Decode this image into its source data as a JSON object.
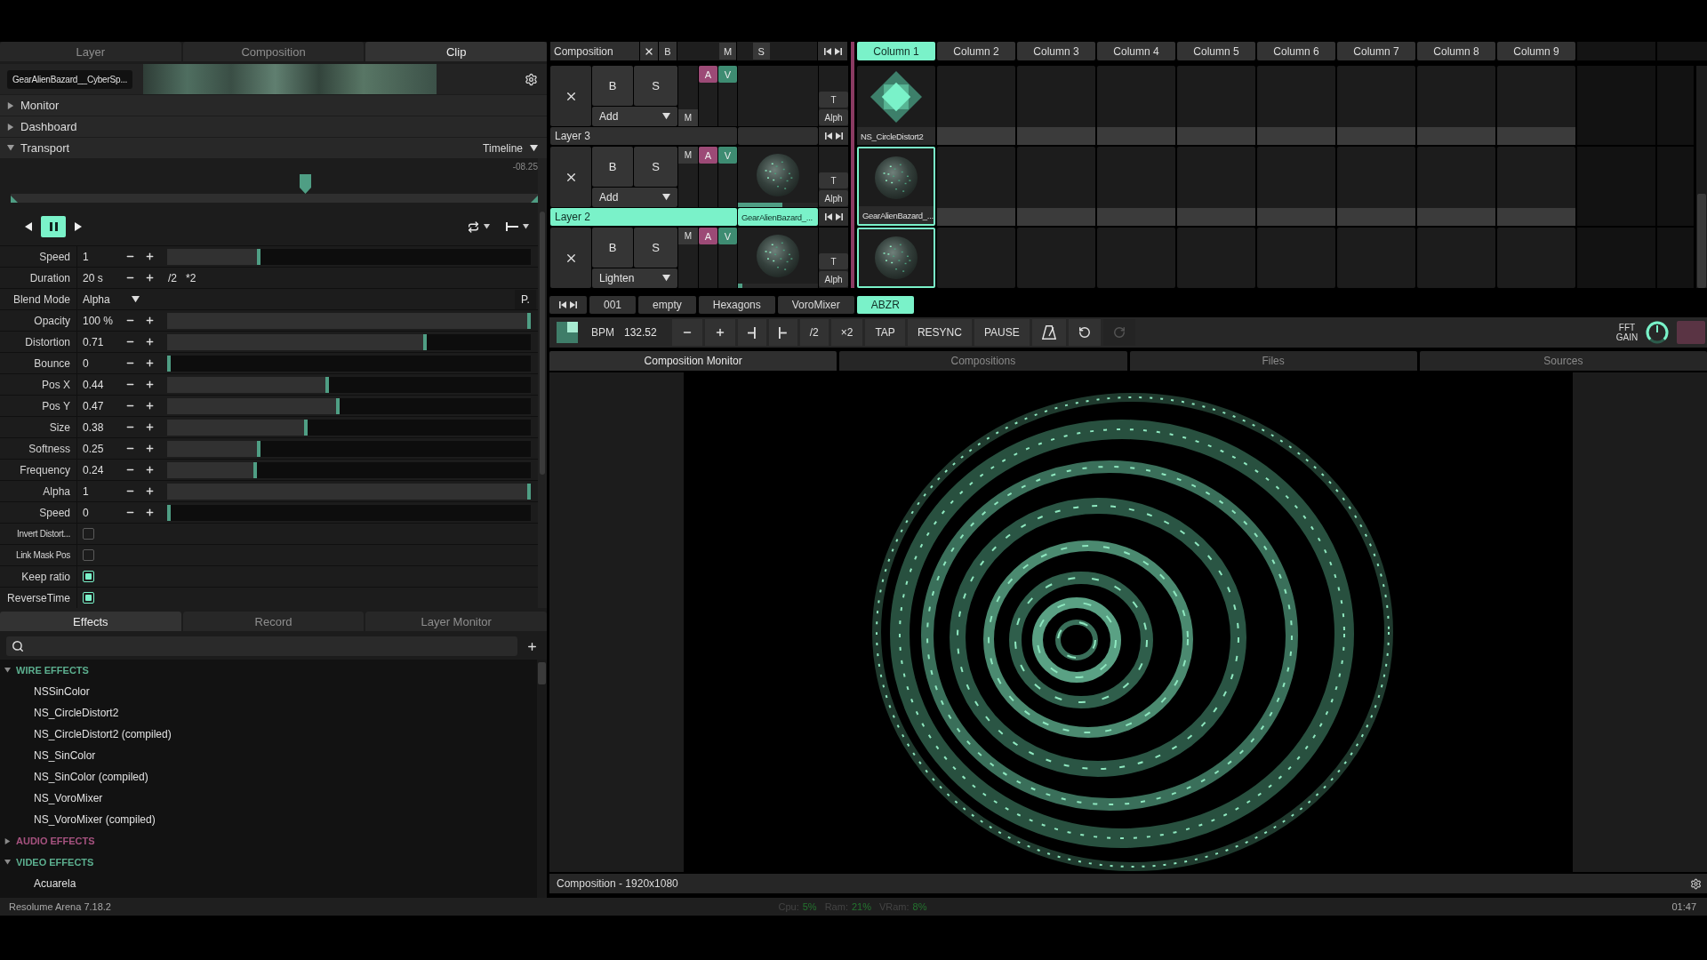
{
  "left_panel": {
    "tabs": [
      {
        "label": "Layer",
        "selected": false
      },
      {
        "label": "Composition",
        "selected": false
      },
      {
        "label": "Clip",
        "selected": true
      }
    ],
    "clip_name": "GearAlienBazard__CyberSp...",
    "sections": [
      {
        "label": "Monitor",
        "expanded": false
      },
      {
        "label": "Dashboard",
        "expanded": false
      },
      {
        "label": "Transport",
        "expanded": true,
        "mode": "Timeline"
      }
    ],
    "timeline": {
      "time": "-08.25",
      "level": 0.56
    },
    "transport": [
      {
        "kind": "backward",
        "selected": false
      },
      {
        "kind": "pause",
        "selected": true
      },
      {
        "kind": "forward",
        "selected": false
      }
    ],
    "params": [
      {
        "kind": "slider",
        "label": "Speed",
        "value": "1",
        "level": 0.25
      },
      {
        "kind": "duration",
        "label": "Duration",
        "value": "20 s",
        "factors": [
          "/2",
          "*2"
        ]
      },
      {
        "kind": "dropdown",
        "label": "Blend Mode",
        "value": "Alpha",
        "button": "P."
      },
      {
        "kind": "slider",
        "label": "Opacity",
        "value": "100 %",
        "level": 1
      },
      {
        "kind": "slider",
        "label": "Distortion",
        "value": "0.71",
        "level": 0.71
      },
      {
        "kind": "slider",
        "label": "Bounce",
        "value": "0",
        "level": 0
      },
      {
        "kind": "slider",
        "label": "Pos X",
        "value": "0.44",
        "level": 0.44
      },
      {
        "kind": "slider",
        "label": "Pos Y",
        "value": "0.47",
        "level": 0.47
      },
      {
        "kind": "slider",
        "label": "Size",
        "value": "0.38",
        "level": 0.38
      },
      {
        "kind": "slider",
        "label": "Softness",
        "value": "0.25",
        "level": 0.25
      },
      {
        "kind": "slider",
        "label": "Frequency",
        "value": "0.24",
        "level": 0.24
      },
      {
        "kind": "slider",
        "label": "Alpha",
        "value": "1",
        "level": 1
      },
      {
        "kind": "slider",
        "label": "Speed",
        "value": "0",
        "level": 0
      },
      {
        "kind": "checkbox",
        "label": "Invert Distort...",
        "checked": false
      },
      {
        "kind": "checkbox",
        "label": "Link Mask Pos",
        "checked": false
      },
      {
        "kind": "checkbox",
        "label": "Keep ratio",
        "checked": true
      },
      {
        "kind": "checkbox",
        "label": "ReverseTime",
        "checked": true
      }
    ],
    "bottom_tabs": [
      {
        "label": "Effects",
        "selected": true
      },
      {
        "label": "Record",
        "selected": false
      },
      {
        "label": "Layer Monitor",
        "selected": false
      }
    ],
    "effects": [
      {
        "label": "WIRE EFFECTS",
        "color": "#5caf8f",
        "expanded": true,
        "children": [
          {
            "label": "NSSinColor"
          },
          {
            "label": "NS_CircleDistort2"
          },
          {
            "label": "NS_CircleDistort2 (compiled)"
          },
          {
            "label": "NS_SinColor"
          },
          {
            "label": "NS_SinColor (compiled)"
          },
          {
            "label": "NS_VoroMixer"
          },
          {
            "label": "NS_VoroMixer (compiled)"
          }
        ]
      },
      {
        "label": "AUDIO EFFECTS",
        "color": "#a6527f",
        "expanded": false
      },
      {
        "label": "VIDEO EFFECTS",
        "color": "#5caf8f",
        "expanded": true,
        "children": [
          {
            "label": "Acuarela"
          }
        ]
      }
    ]
  },
  "deck": {
    "label": "Composition",
    "buttons": [
      "B"
    ],
    "master": {
      "label": "M",
      "level": 1
    },
    "speed": {
      "label": "S",
      "level": 0.25
    },
    "columns": [
      {
        "label": "Column 1",
        "selected": true
      },
      {
        "label": "Column 2",
        "selected": false
      },
      {
        "label": "Column 3",
        "selected": false
      },
      {
        "label": "Column 4",
        "selected": false
      },
      {
        "label": "Column 5",
        "selected": false
      },
      {
        "label": "Column 6",
        "selected": false
      },
      {
        "label": "Column 7",
        "selected": false
      },
      {
        "label": "Column 8",
        "selected": false
      },
      {
        "label": "Column 9",
        "selected": false
      }
    ],
    "layers": [
      {
        "name": "Layer 3",
        "selected": false,
        "buttons": [
          "B",
          "S"
        ],
        "blend": "Add",
        "fader": {
          "label": "M",
          "level": 0
        },
        "toggles": [
          {
            "label": "A",
            "kind": "audio"
          },
          {
            "label": "V",
            "kind": "video"
          }
        ],
        "preview": {
          "kind": "empty"
        },
        "transition": [
          "T",
          "Alph"
        ],
        "clips": [
          {
            "kind": "diamond",
            "name": "NS_CircleDistort2",
            "selected": false
          },
          {
            "kind": "empty",
            "selected": false
          },
          {
            "kind": "empty",
            "selected": false
          },
          {
            "kind": "empty",
            "selected": false
          },
          {
            "kind": "empty",
            "selected": false
          },
          {
            "kind": "empty",
            "selected": false
          },
          {
            "kind": "empty",
            "selected": false
          },
          {
            "kind": "empty",
            "selected": false
          },
          {
            "kind": "empty",
            "selected": false
          }
        ]
      },
      {
        "name": "Layer 2",
        "selected": true,
        "buttons": [
          "B",
          "S"
        ],
        "blend": "Add",
        "fader": {
          "label": "M",
          "level": 1
        },
        "toggles": [
          {
            "label": "A",
            "kind": "audio"
          },
          {
            "label": "V",
            "kind": "video"
          }
        ],
        "preview": {
          "kind": "sphere",
          "name": "GearAlienBazard_...",
          "level": 0.55
        },
        "transition": [
          "T",
          "Alph"
        ],
        "clips": [
          {
            "kind": "sphere",
            "name": "GearAlienBazard_...",
            "selected": true
          },
          {
            "kind": "empty",
            "selected": false
          },
          {
            "kind": "empty",
            "selected": false
          },
          {
            "kind": "empty",
            "selected": false
          },
          {
            "kind": "empty",
            "selected": false
          },
          {
            "kind": "empty",
            "selected": false
          },
          {
            "kind": "empty",
            "selected": false
          },
          {
            "kind": "empty",
            "selected": false
          },
          {
            "kind": "empty",
            "selected": false
          }
        ]
      },
      {
        "buttons": [
          "B",
          "S"
        ],
        "blend": "Lighten",
        "fader": {
          "label": "M",
          "level": 1
        },
        "toggles": [
          {
            "label": "A",
            "kind": "audio"
          },
          {
            "label": "V",
            "kind": "video"
          }
        ],
        "preview": {
          "kind": "sphere",
          "level": 0.06
        },
        "transition": [
          "T",
          "Alph"
        ],
        "clips": [
          {
            "kind": "sphere",
            "selected": true
          },
          {
            "kind": "empty",
            "selected": false
          },
          {
            "kind": "empty",
            "selected": false
          },
          {
            "kind": "empty",
            "selected": false
          },
          {
            "kind": "empty",
            "selected": false
          },
          {
            "kind": "empty",
            "selected": false
          },
          {
            "kind": "empty",
            "selected": false
          },
          {
            "kind": "empty",
            "selected": false
          },
          {
            "kind": "empty",
            "selected": false
          }
        ]
      }
    ]
  },
  "deck_tabs": [
    {
      "label": "001",
      "selected": false
    },
    {
      "label": "empty",
      "selected": false
    },
    {
      "label": "Hexagons",
      "selected": false
    },
    {
      "label": "VoroMixer",
      "selected": false
    },
    {
      "label": "ABZR",
      "selected": true
    }
  ],
  "transport_bar": {
    "bpm_label": "BPM",
    "bpm": "132.52",
    "buttons": [
      {
        "kind": "minus",
        "disabled": false
      },
      {
        "kind": "plus",
        "disabled": false
      },
      {
        "kind": "nudge_back",
        "disabled": false
      },
      {
        "kind": "nudge_forward",
        "disabled": false
      },
      {
        "kind": "text",
        "label": "/2",
        "disabled": false
      },
      {
        "kind": "text",
        "label": "×2",
        "disabled": false
      },
      {
        "kind": "text",
        "label": "TAP",
        "disabled": false
      },
      {
        "kind": "text",
        "label": "RESYNC",
        "disabled": false
      },
      {
        "kind": "text",
        "label": "PAUSE",
        "disabled": false
      },
      {
        "kind": "metronome",
        "disabled": false
      },
      {
        "kind": "undo",
        "disabled": false
      },
      {
        "kind": "redo",
        "disabled": true
      }
    ],
    "gain_label": "FFT GAIN"
  },
  "monitor": {
    "tabs": [
      {
        "label": "Composition Monitor",
        "selected": true
      },
      {
        "label": "Compositions",
        "selected": false
      },
      {
        "label": "Files",
        "selected": false
      },
      {
        "label": "Sources",
        "selected": false
      }
    ],
    "caption": "Composition - 1920x1080"
  },
  "status_bar": {
    "app": "Resolume Arena 7.18.2",
    "stats": [
      {
        "label": "Cpu:",
        "value": "5%"
      },
      {
        "label": "Ram:",
        "value": "21%"
      },
      {
        "label": "VRam:",
        "value": "8%"
      }
    ],
    "time": "01:47"
  }
}
